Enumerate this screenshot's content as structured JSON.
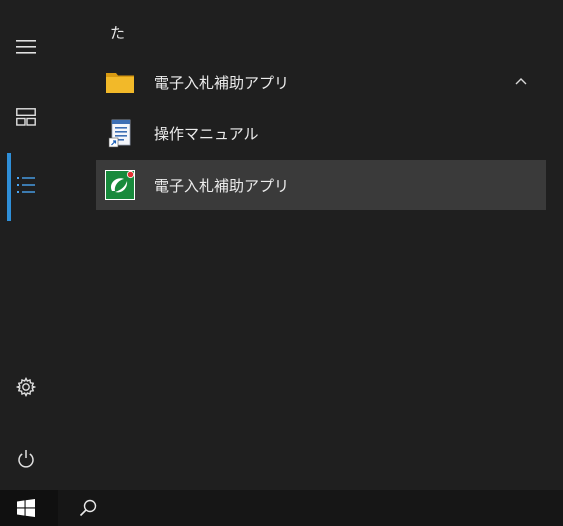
{
  "start_menu": {
    "section_letter": "た",
    "folder": {
      "label": "電子入札補助アプリ",
      "icon": "folder-icon",
      "expanded": true
    },
    "items": [
      {
        "label": "操作マニュアル",
        "icon": "manual-document-icon"
      },
      {
        "label": "電子入札補助アプリ",
        "icon": "app-logo-icon"
      }
    ]
  },
  "rail": {
    "icons": [
      "hamburger-menu-icon",
      "tiles-icon",
      "list-icon",
      "settings-gear-icon",
      "power-icon"
    ]
  },
  "taskbar": {
    "icons": [
      "windows-logo-icon",
      "search-icon"
    ]
  },
  "colors": {
    "accent": "#2f8fd8",
    "background": "#1f1f1f",
    "highlight": "#3a3a3a",
    "folder": "#f0b829",
    "app_green": "#1a8a3a"
  }
}
